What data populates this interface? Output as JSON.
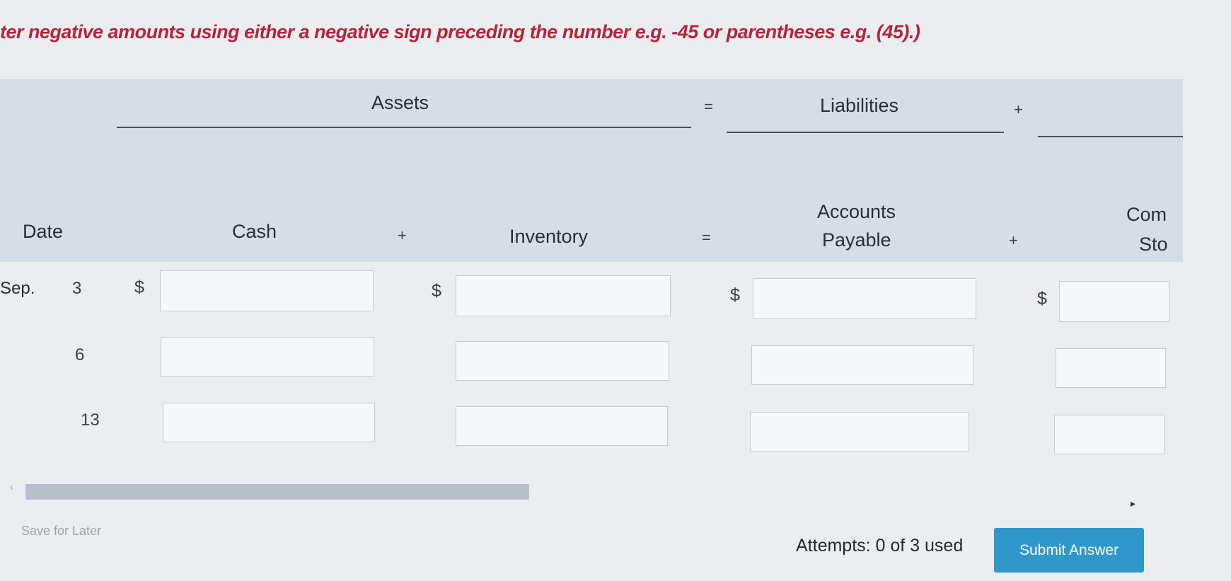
{
  "instruction": "ter negative amounts using either a negative sign preceding the number e.g. -45 or parentheses e.g. (45).)",
  "equation": {
    "assets": "Assets",
    "eq1": "=",
    "liabilities": "Liabilities",
    "plus1": "+"
  },
  "columns": {
    "date": "Date",
    "cash": "Cash",
    "plus_a": "+",
    "inventory": "Inventory",
    "eq2": "=",
    "ap_line1": "Accounts",
    "ap_line2": "Payable",
    "plus_b": "+",
    "cs_line1": "Com",
    "cs_line2": "Sto"
  },
  "rows": [
    {
      "month": "Sep.",
      "day": "3",
      "dollar": "$",
      "cash": "",
      "inventory": "",
      "accounts_payable": "",
      "common_stock": ""
    },
    {
      "month": "",
      "day": "6",
      "dollar": "",
      "cash": "",
      "inventory": "",
      "accounts_payable": "",
      "common_stock": ""
    },
    {
      "month": "",
      "day": "13",
      "dollar": "",
      "cash": "",
      "inventory": "",
      "accounts_payable": "",
      "common_stock": ""
    }
  ],
  "scrollbar": {
    "left_arrow": "‹",
    "right_arrow": "▸",
    "thumb_fraction": 0.43
  },
  "footer": {
    "save_label": "Save for Later",
    "attempts_text": "Attempts: 0 of 3 used",
    "submit_label": "Submit Answer"
  },
  "colors": {
    "instruction": "#b3253a",
    "header_band": "#d7dde7",
    "submit_button": "#2f97c9",
    "scroll_thumb": "#b7bfcd"
  }
}
